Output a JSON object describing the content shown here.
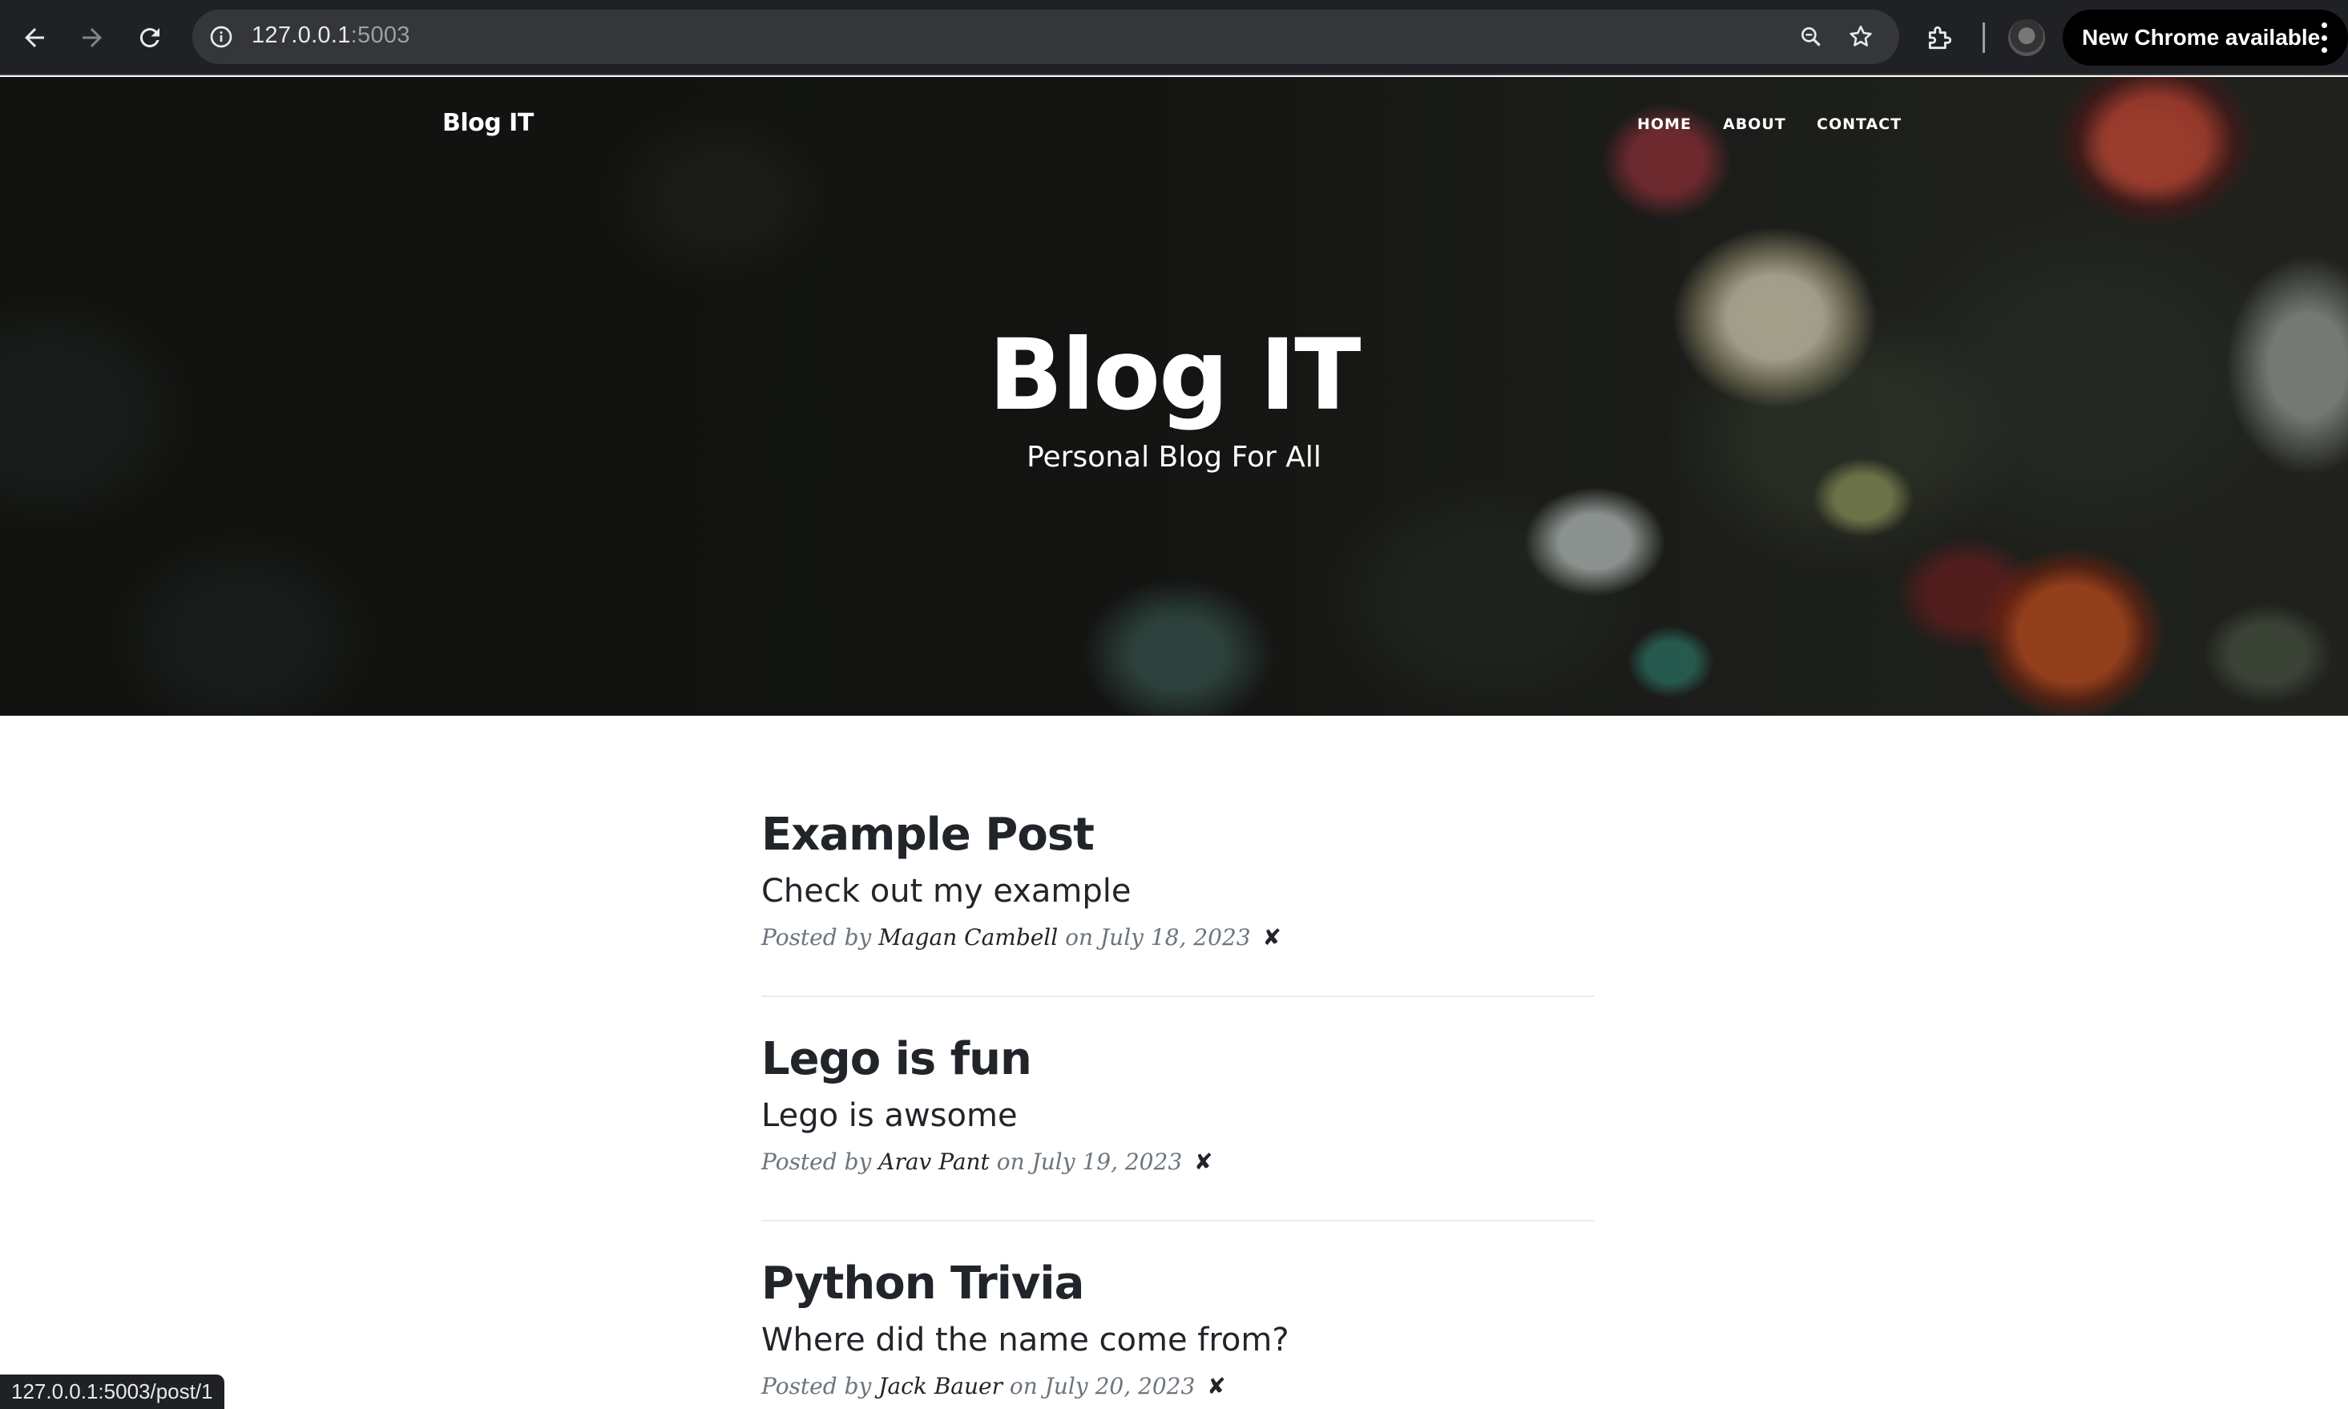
{
  "browser": {
    "url_host": "127.0.0.1",
    "url_port": ":5003",
    "update_label": "New Chrome available",
    "status_url": "127.0.0.1:5003/post/1"
  },
  "site": {
    "brand": "Blog IT",
    "nav": {
      "home": "HOME",
      "about": "ABOUT",
      "contact": "CONTACT"
    },
    "heading": "Blog IT",
    "subheading": "Personal Blog For All"
  },
  "posts": [
    {
      "title": "Example Post",
      "subtitle": "Check out my example",
      "posted_by": "Posted by",
      "author": "Magan Cambell",
      "date": "on July 18, 2023",
      "delete_label": "✘"
    },
    {
      "title": "Lego is fun",
      "subtitle": "Lego is awsome",
      "posted_by": "Posted by",
      "author": "Arav Pant",
      "date": "on July 19, 2023",
      "delete_label": "✘"
    },
    {
      "title": "Python Trivia",
      "subtitle": "Where did the name come from?",
      "posted_by": "Posted by",
      "author": "Jack Bauer",
      "date": "on July 20, 2023",
      "delete_label": "✘"
    }
  ],
  "colors": {
    "chrome_bg": "#202124",
    "omnibox_bg": "#35363a",
    "text_dark": "#212529",
    "meta_gray": "#6c757d",
    "divider": "#e9ecef"
  }
}
